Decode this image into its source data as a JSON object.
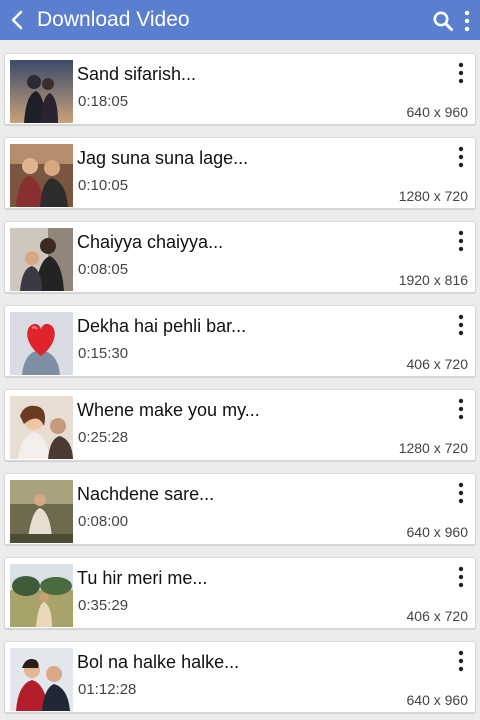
{
  "appbar": {
    "title": "Download Video",
    "back_icon": "chevron-left-icon",
    "search_icon": "search-icon",
    "menu_icon": "more-vertical-icon",
    "color": "#5b7fcf"
  },
  "videos": [
    {
      "title": "Sand sifarish...",
      "duration": "0:18:05",
      "resolution": "640 x 960"
    },
    {
      "title": "Jag suna suna lage...",
      "duration": "0:10:05",
      "resolution": "1280 x 720"
    },
    {
      "title": "Chaiyya chaiyya...",
      "duration": "0:08:05",
      "resolution": "1920 x 816"
    },
    {
      "title": "Dekha hai pehli bar...",
      "duration": "0:15:30",
      "resolution": "406 x 720"
    },
    {
      "title": "Whene make you my...",
      "duration": "0:25:28",
      "resolution": "1280 x 720"
    },
    {
      "title": "Nachdene sare...",
      "duration": "0:08:00",
      "resolution": "640 x 960"
    },
    {
      "title": "Tu hir meri me...",
      "duration": "0:35:29",
      "resolution": "406 x 720"
    },
    {
      "title": "Bol na halke halke...",
      "duration": "01:12:28",
      "resolution": "640 x 960"
    }
  ]
}
